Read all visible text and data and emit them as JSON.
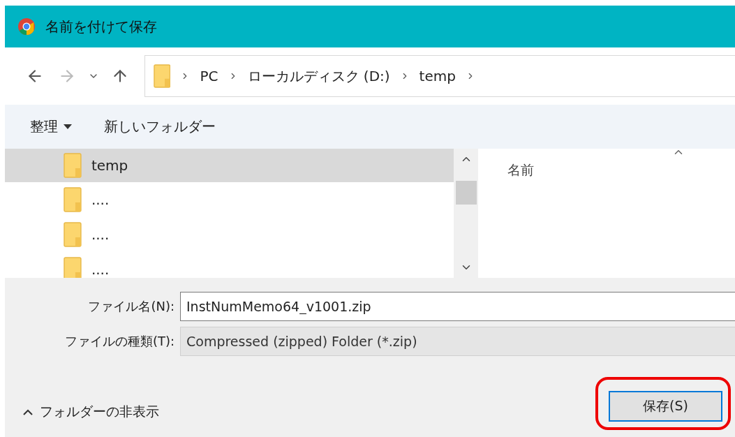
{
  "window": {
    "title": "名前を付けて保存"
  },
  "navigation": {
    "back_disabled": false,
    "forward_disabled": true
  },
  "breadcrumb": [
    "PC",
    "ローカルディスク (D:)",
    "temp"
  ],
  "toolbar": {
    "organize": "整理",
    "new_folder": "新しいフォルダー"
  },
  "tree": [
    {
      "label": "temp",
      "selected": true
    },
    {
      "label": "....",
      "selected": false
    },
    {
      "label": "....",
      "selected": false
    },
    {
      "label": "....",
      "selected": false
    }
  ],
  "file_list": {
    "column": "名前"
  },
  "form": {
    "file_name_label": "ファイル名(N):",
    "file_name": "InstNumMemo64_v1001.zip",
    "file_type_label": "ファイルの種類(T):",
    "file_type": "Compressed (zipped) Folder (*.zip)"
  },
  "hide_folders": "フォルダーの非表示",
  "save_button": {
    "label": "保存(S)",
    "highlighted": true
  }
}
